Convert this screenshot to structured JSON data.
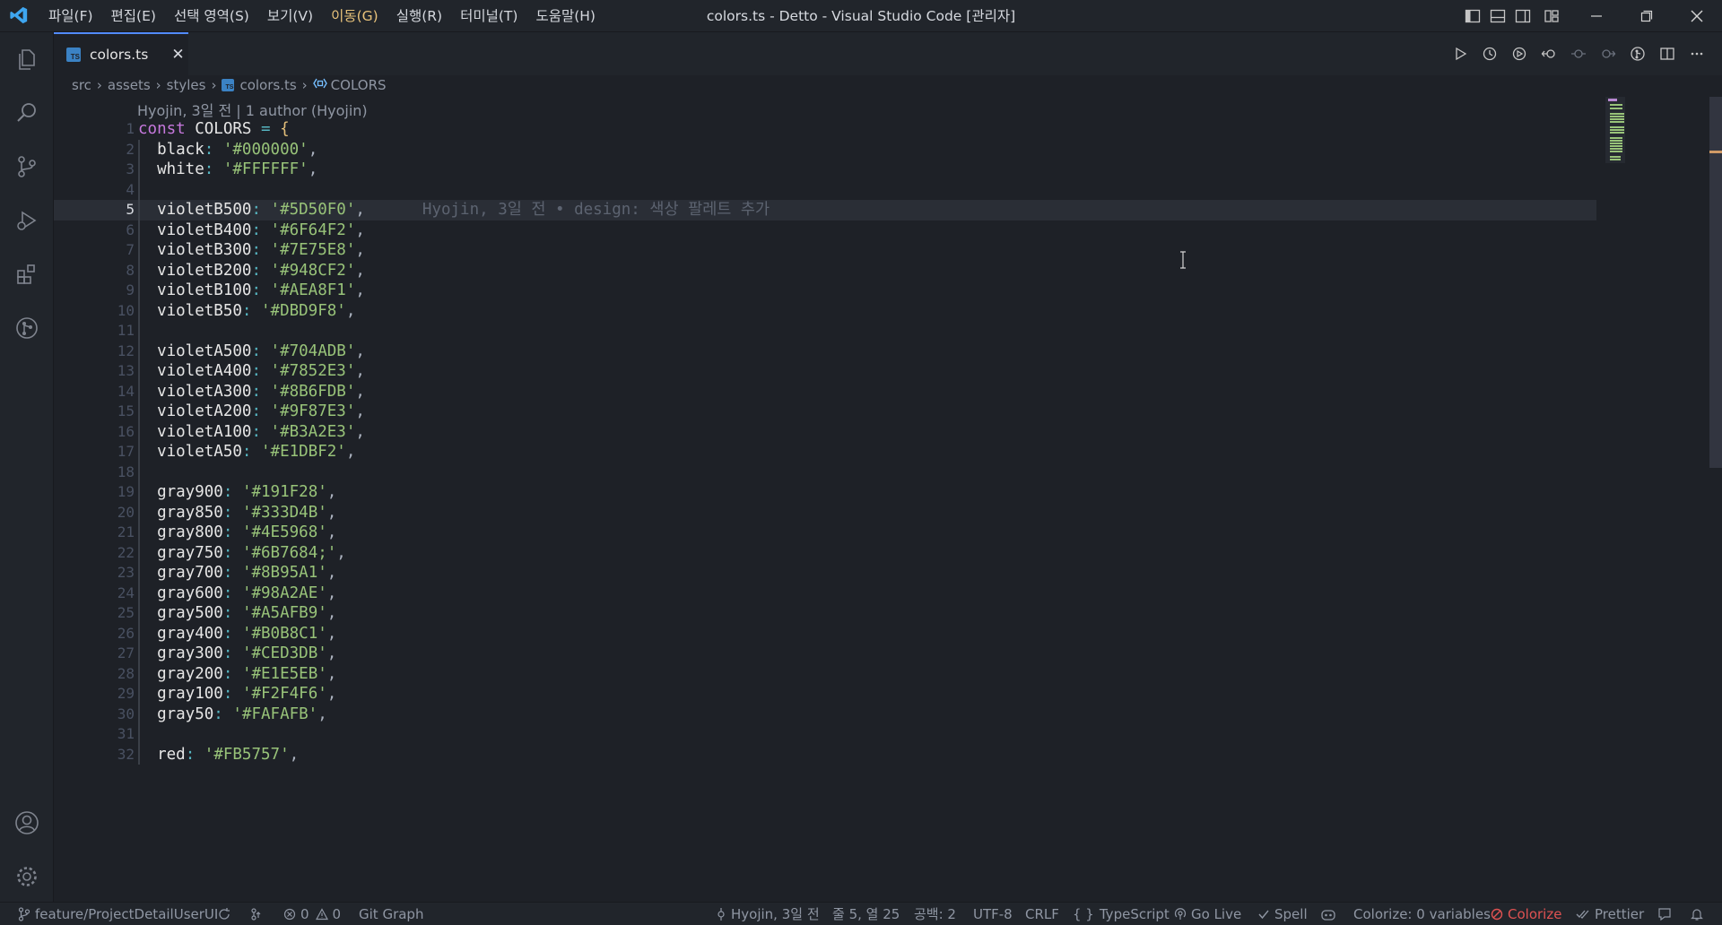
{
  "window": {
    "title": "colors.ts - Detto - Visual Studio Code [관리자]"
  },
  "menu": [
    {
      "label": "파일(F)"
    },
    {
      "label": "편집(E)"
    },
    {
      "label": "선택 영역(S)"
    },
    {
      "label": "보기(V)"
    },
    {
      "label": "이동(G)",
      "active": true
    },
    {
      "label": "실행(R)"
    },
    {
      "label": "터미널(T)"
    },
    {
      "label": "도움말(H)"
    }
  ],
  "activitybar": [
    "files-icon",
    "search-icon",
    "source-control-icon",
    "run-debug-icon",
    "extensions-icon",
    "git-graph-icon",
    "account-icon",
    "settings-gear-icon"
  ],
  "tab": {
    "label": "colors.ts",
    "icon_text": "TS",
    "close": "✕"
  },
  "breadcrumb": {
    "items": [
      "src",
      "assets",
      "styles"
    ],
    "file": "colors.ts",
    "symbol": "COLORS"
  },
  "blame_header": "Hyojin, 3일 전 | 1 author (Hyojin)",
  "inline_blame": "Hyojin, 3일 전 • design: 색상 팔레트 추가",
  "current_line": 5,
  "code_lines": [
    {
      "n": "1",
      "key": "",
      "val": "",
      "kind": "decl"
    },
    {
      "n": "2",
      "key": "black",
      "val": "'#000000'"
    },
    {
      "n": "3",
      "key": "white",
      "val": "'#FFFFFF'"
    },
    {
      "n": "4",
      "key": "",
      "val": ""
    },
    {
      "n": "5",
      "key": "violetB500",
      "val": "'#5D50F0'"
    },
    {
      "n": "6",
      "key": "violetB400",
      "val": "'#6F64F2'"
    },
    {
      "n": "7",
      "key": "violetB300",
      "val": "'#7E75E8'"
    },
    {
      "n": "8",
      "key": "violetB200",
      "val": "'#948CF2'"
    },
    {
      "n": "9",
      "key": "violetB100",
      "val": "'#AEA8F1'"
    },
    {
      "n": "10",
      "key": "violetB50",
      "val": "'#DBD9F8'"
    },
    {
      "n": "11",
      "key": "",
      "val": ""
    },
    {
      "n": "12",
      "key": "violetA500",
      "val": "'#704ADB'"
    },
    {
      "n": "13",
      "key": "violetA400",
      "val": "'#7852E3'"
    },
    {
      "n": "14",
      "key": "violetA300",
      "val": "'#8B6FDB'"
    },
    {
      "n": "15",
      "key": "violetA200",
      "val": "'#9F87E3'"
    },
    {
      "n": "16",
      "key": "violetA100",
      "val": "'#B3A2E3'"
    },
    {
      "n": "17",
      "key": "violetA50",
      "val": "'#E1DBF2'"
    },
    {
      "n": "18",
      "key": "",
      "val": ""
    },
    {
      "n": "19",
      "key": "gray900",
      "val": "'#191F28'"
    },
    {
      "n": "20",
      "key": "gray850",
      "val": "'#333D4B'"
    },
    {
      "n": "21",
      "key": "gray800",
      "val": "'#4E5968'"
    },
    {
      "n": "22",
      "key": "gray750",
      "val": "'#6B7684;'"
    },
    {
      "n": "23",
      "key": "gray700",
      "val": "'#8B95A1'"
    },
    {
      "n": "24",
      "key": "gray600",
      "val": "'#98A2AE'"
    },
    {
      "n": "25",
      "key": "gray500",
      "val": "'#A5AFB9'"
    },
    {
      "n": "26",
      "key": "gray400",
      "val": "'#B0B8C1'"
    },
    {
      "n": "27",
      "key": "gray300",
      "val": "'#CED3DB'"
    },
    {
      "n": "28",
      "key": "gray200",
      "val": "'#E1E5EB'"
    },
    {
      "n": "29",
      "key": "gray100",
      "val": "'#F2F4F6'"
    },
    {
      "n": "30",
      "key": "gray50",
      "val": "'#FAFAFB'"
    },
    {
      "n": "31",
      "key": "",
      "val": ""
    },
    {
      "n": "32",
      "key": "red",
      "val": "'#FB5757'"
    }
  ],
  "decl": {
    "kw": "const",
    "name": "COLORS",
    "op": "=",
    "brace": "{"
  },
  "statusbar": {
    "branch": "feature/ProjectDetailUserUI",
    "errors": "0",
    "warnings": "0",
    "git_graph": "Git Graph",
    "blame": "Hyojin, 3일 전",
    "position": "줄 5, 열 25",
    "spaces": "공백: 2",
    "encoding": "UTF-8",
    "eol": "CRLF",
    "language": "TypeScript",
    "golive": "Go Live",
    "spell": "Spell",
    "colorize_vars": "Colorize: 0 variables",
    "colorize": "Colorize",
    "prettier": "Prettier"
  },
  "colors": {
    "accent": "#528bff",
    "keyword": "#c678dd",
    "string": "#98c379",
    "variable": "#e5c07b",
    "error": "#e05252"
  }
}
